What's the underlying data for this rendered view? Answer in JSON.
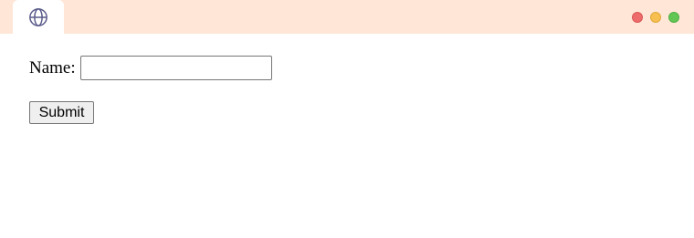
{
  "window": {
    "tab_icon": "globe-icon",
    "controls": {
      "close_color": "#ee6b6b",
      "minimize_color": "#f6bf4f",
      "maximize_color": "#62c655"
    },
    "titlebar_color": "#ffe6d6"
  },
  "form": {
    "name_label": "Name:",
    "name_value": "",
    "name_placeholder": "",
    "submit_label": "Submit"
  }
}
